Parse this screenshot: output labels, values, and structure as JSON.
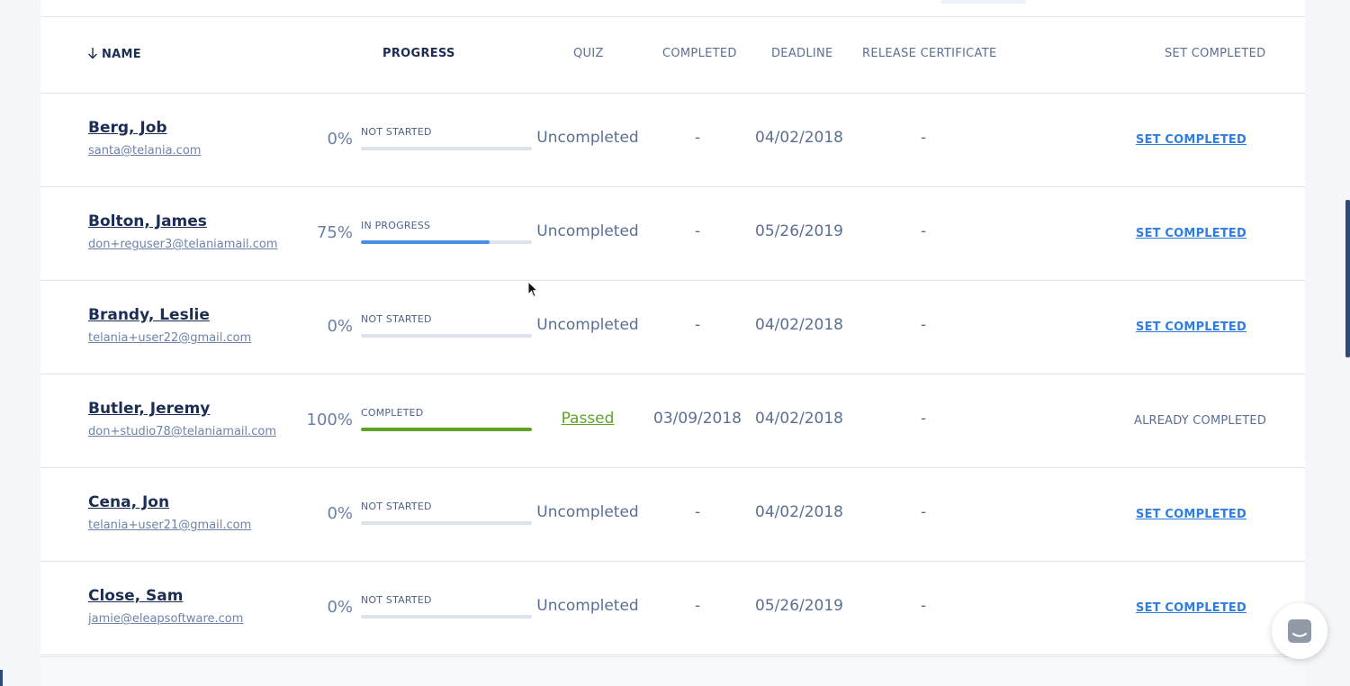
{
  "table": {
    "headers": {
      "name": "NAME",
      "progress": "PROGRESS",
      "quiz": "QUIZ",
      "completed": "COMPLETED",
      "deadline": "DEADLINE",
      "release_certificate": "RELEASE CERTIFICATE",
      "set_completed": "SET COMPLETED"
    },
    "rows": [
      {
        "name": "Berg, Job",
        "email": "santa@telania.com",
        "percent": "0%",
        "progress_fraction": 0,
        "status": "NOT STARTED",
        "quiz": "Uncompleted",
        "completed": "-",
        "deadline": "04/02/2018",
        "certificate": "-",
        "action": "SET COMPLETED"
      },
      {
        "name": "Bolton, James",
        "email": "don+reguser3@telaniamail.com",
        "percent": "75%",
        "progress_fraction": 0.75,
        "status": "IN PROGRESS",
        "quiz": "Uncompleted",
        "completed": "-",
        "deadline": "05/26/2019",
        "certificate": "-",
        "action": "SET COMPLETED"
      },
      {
        "name": "Brandy, Leslie",
        "email": "telania+user22@gmail.com",
        "percent": "0%",
        "progress_fraction": 0,
        "status": "NOT STARTED",
        "quiz": "Uncompleted",
        "completed": "-",
        "deadline": "04/02/2018",
        "certificate": "-",
        "action": "SET COMPLETED"
      },
      {
        "name": "Butler, Jeremy",
        "email": "don+studio78@telaniamail.com",
        "percent": "100%",
        "progress_fraction": 1,
        "status": "COMPLETED",
        "quiz": "Passed",
        "completed": "03/09/2018",
        "deadline": "04/02/2018",
        "certificate": "-",
        "action": "ALREADY COMPLETED"
      },
      {
        "name": "Cena, Jon",
        "email": "telania+user21@gmail.com",
        "percent": "0%",
        "progress_fraction": 0,
        "status": "NOT STARTED",
        "quiz": "Uncompleted",
        "completed": "-",
        "deadline": "04/02/2018",
        "certificate": "-",
        "action": "SET COMPLETED"
      },
      {
        "name": "Close, Sam",
        "email": "jamie@eleapsoftware.com",
        "percent": "0%",
        "progress_fraction": 0,
        "status": "NOT STARTED",
        "quiz": "Uncompleted",
        "completed": "-",
        "deadline": "05/26/2019",
        "certificate": "-",
        "action": "SET COMPLETED"
      }
    ]
  },
  "colors": {
    "accent_link": "#2f7de1",
    "progress_in_progress": "#4a90e2",
    "progress_complete": "#5ea326",
    "passed": "#5ea326",
    "name_text": "#1c2e54"
  },
  "icons": {
    "sort": "arrow-down-icon",
    "chat": "chat-icon",
    "cursor": "mouse-cursor-icon"
  }
}
